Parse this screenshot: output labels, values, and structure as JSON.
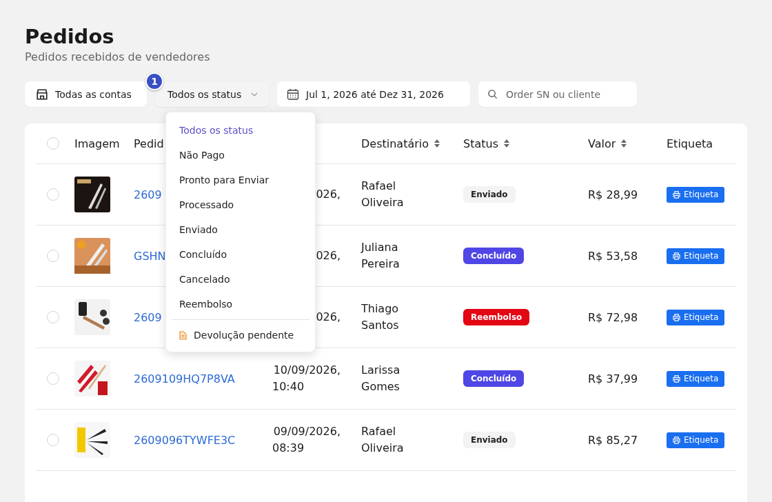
{
  "page": {
    "title": "Pedidos",
    "subtitle": "Pedidos recebidos de vendedores"
  },
  "filters": {
    "account": "Todas as contas",
    "status": "Todos os status",
    "status_badge": "1",
    "date_range": "Jul 1, 2026 até Dez 31, 2026",
    "search": {
      "placeholder": "Order SN ou cliente"
    }
  },
  "status_menu": {
    "items": [
      {
        "label": "Todos os status",
        "selected": true,
        "kind": "option"
      },
      {
        "label": "Não Pago",
        "selected": false,
        "kind": "option"
      },
      {
        "label": "Pronto para Enviar",
        "selected": false,
        "kind": "option"
      },
      {
        "label": "Processado",
        "selected": false,
        "kind": "option"
      },
      {
        "label": "Enviado",
        "selected": false,
        "kind": "option"
      },
      {
        "label": "Concluído",
        "selected": false,
        "kind": "option"
      },
      {
        "label": "Cancelado",
        "selected": false,
        "kind": "option"
      },
      {
        "label": "Reembolso",
        "selected": false,
        "kind": "option"
      },
      {
        "label": "Devolução pendente",
        "selected": false,
        "kind": "document"
      }
    ]
  },
  "table": {
    "select_all_checked": false,
    "columns": [
      "Imagem",
      "Pedid",
      "Destinatário",
      "Status",
      "Valor",
      "Etiqueta"
    ],
    "rows": [
      {
        "checked": false,
        "order": "2609",
        "date": "026,",
        "recipient": "Rafael Oliveira",
        "status": "Enviado",
        "color": "#f3f3f3",
        "value": "R$ 28,99",
        "label": "Etiqueta"
      },
      {
        "checked": false,
        "order": "GSHN",
        "date": "026,",
        "recipient": "Juliana Pereira",
        "status": "Concluído",
        "color": "#4f46e5",
        "value": "R$ 53,58",
        "label": "Etiqueta"
      },
      {
        "checked": false,
        "order": "2609",
        "date": "026,",
        "recipient": "Thiago Santos",
        "status": "Reembolso",
        "color": "#e30613",
        "value": "R$ 72,98",
        "label": "Etiqueta"
      },
      {
        "checked": false,
        "order": "2609109HQ7P8VA",
        "date": "10/09/2026,",
        "time": "10:40",
        "recipient": "Larissa Gomes",
        "status": "Concluído",
        "color": "#4f46e5",
        "value": "R$ 37,99",
        "label": "Etiqueta"
      },
      {
        "checked": false,
        "order": "2609096TYWFE3C",
        "date": "09/09/2026,",
        "time": "08:39",
        "recipient": "Rafael Oliveira",
        "status": "Enviado",
        "color": "#f3f3f3",
        "value": "R$ 85,27",
        "label": "Etiqueta"
      }
    ]
  }
}
